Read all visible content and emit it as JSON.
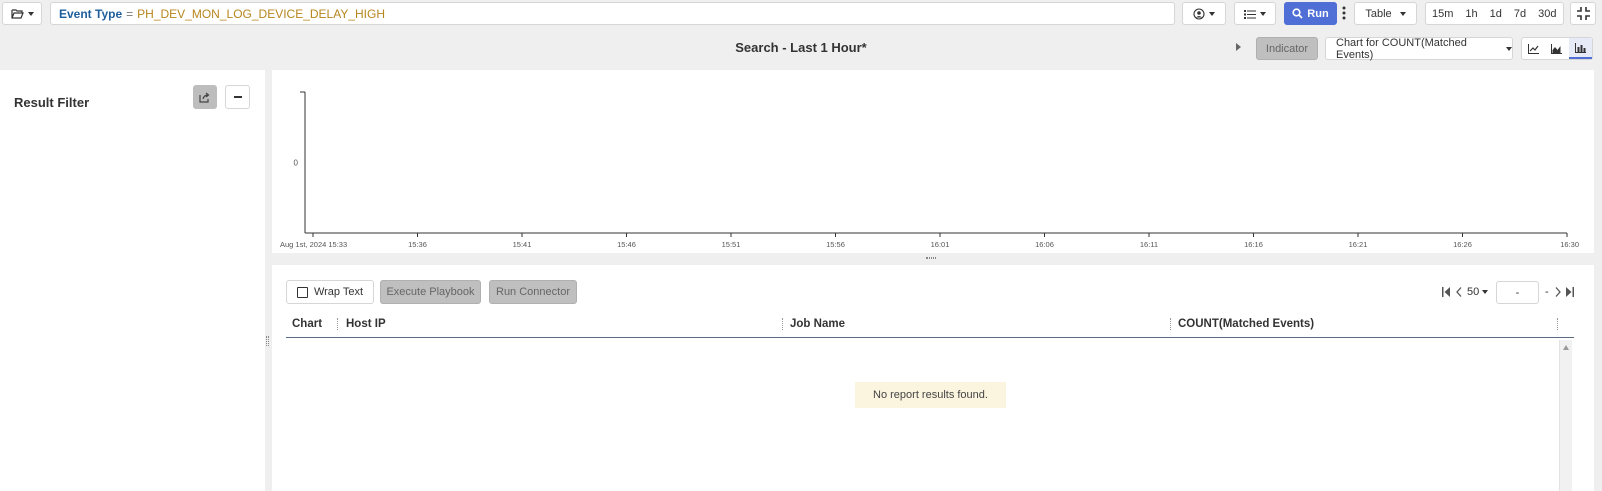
{
  "toolbar": {
    "search_key": "Event Type",
    "search_op": "=",
    "search_value": "PH_DEV_MON_LOG_DEVICE_DELAY_HIGH",
    "run_label": "Run",
    "view_select": "Table",
    "time_ranges": [
      "15m",
      "1h",
      "1d",
      "7d",
      "30d"
    ]
  },
  "search_title": "Search - Last 1 Hour*",
  "chart_controls": {
    "indicator_label": "Indicator",
    "chart_select": "Chart for COUNT(Matched Events)"
  },
  "result_filter": {
    "title": "Result Filter"
  },
  "chart_data": {
    "type": "line",
    "x_ticks": [
      "Aug 1st, 2024 15:33",
      "15:36",
      "15:41",
      "15:46",
      "15:51",
      "15:56",
      "16:01",
      "16:06",
      "16:11",
      "16:16",
      "16:21",
      "16:26",
      "16:30"
    ],
    "y_ticks": [
      "0"
    ],
    "series": [],
    "grid": false
  },
  "table": {
    "buttons": {
      "wrap_text": "Wrap Text",
      "execute_playbook": "Execute Playbook",
      "run_connector": "Run Connector"
    },
    "pagination": {
      "page_size": "50",
      "page_input": "-",
      "page_total": "-"
    },
    "columns": [
      "Chart",
      "Host IP",
      "Job Name",
      "COUNT(Matched Events)"
    ],
    "empty_message": "No report results found."
  },
  "colors": {
    "accent": "#4f6ed6",
    "search_key": "#1f5f9c",
    "search_value": "#b7861d",
    "empty_bg": "#fbf5df"
  }
}
